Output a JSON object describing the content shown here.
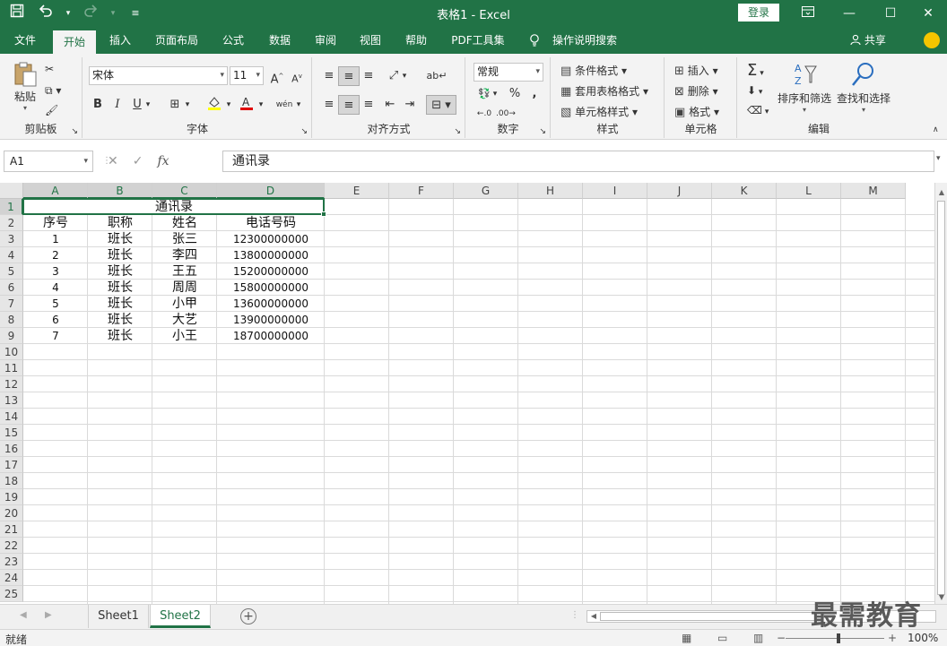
{
  "titlebar": {
    "title": "表格1  -  Excel",
    "login": "登录",
    "save_icon": "save-icon",
    "undo_icon": "undo-icon",
    "redo_icon": "redo-icon",
    "customize_icon": "customize-qat-icon",
    "restore_ribbon_icon": "ribbon-display-icon",
    "minimize_icon": "minimize-icon",
    "maximize_icon": "maximize-icon",
    "close_icon": "close-icon"
  },
  "tabs": {
    "file": "文件",
    "home": "开始",
    "insert": "插入",
    "page_layout": "页面布局",
    "formulas": "公式",
    "data": "数据",
    "review": "审阅",
    "view": "视图",
    "help": "帮助",
    "pdf": "PDF工具集",
    "tell_me": "操作说明搜索",
    "share": "共享"
  },
  "ribbon": {
    "clipboard": {
      "label": "剪贴板",
      "paste": "粘贴"
    },
    "font": {
      "label": "字体",
      "font_name": "宋体",
      "font_size": "11",
      "bold": "B",
      "italic": "I",
      "underline": "U",
      "phonetic": "wén"
    },
    "alignment": {
      "label": "对齐方式"
    },
    "number": {
      "label": "数字",
      "format": "常规",
      "percent": "%",
      "comma": ","
    },
    "styles": {
      "label": "样式",
      "conditional": "条件格式",
      "table": "套用表格格式",
      "cell_styles": "单元格样式"
    },
    "cells": {
      "label": "单元格",
      "insert": "插入",
      "delete": "删除",
      "format": "格式"
    },
    "editing": {
      "label": "编辑",
      "sort": "排序和筛选",
      "find": "查找和选择"
    }
  },
  "formula_bar": {
    "name_box": "A1",
    "cancel": "✕",
    "enter": "✓",
    "fx": "fx",
    "content": "通讯录"
  },
  "columns": [
    "A",
    "B",
    "C",
    "D",
    "E",
    "F",
    "G",
    "H",
    "I",
    "J",
    "K",
    "L",
    "M"
  ],
  "rows": [
    "1",
    "2",
    "3",
    "4",
    "5",
    "6",
    "7",
    "8",
    "9",
    "10",
    "11",
    "12",
    "13",
    "14",
    "15",
    "16",
    "17",
    "18",
    "19",
    "20",
    "21",
    "22",
    "23",
    "24",
    "25"
  ],
  "table": {
    "title": "通讯录",
    "headers": [
      "序号",
      "职称",
      "姓名",
      "电话号码"
    ],
    "data": [
      [
        "1",
        "班长",
        "张三",
        "12300000000"
      ],
      [
        "2",
        "班长",
        "李四",
        "13800000000"
      ],
      [
        "3",
        "班长",
        "王五",
        "15200000000"
      ],
      [
        "4",
        "班长",
        "周周",
        "15800000000"
      ],
      [
        "5",
        "班长",
        "小甲",
        "13600000000"
      ],
      [
        "6",
        "班长",
        "大艺",
        "13900000000"
      ],
      [
        "7",
        "班长",
        "小王",
        "18700000000"
      ]
    ]
  },
  "sheets": [
    "Sheet1",
    "Sheet2"
  ],
  "active_sheet": "Sheet2",
  "status": {
    "ready": "就绪",
    "zoom": "100%",
    "zoom_minus": "−",
    "zoom_plus": "+"
  },
  "watermark": "最需教育",
  "colors": {
    "accent": "#217346"
  }
}
